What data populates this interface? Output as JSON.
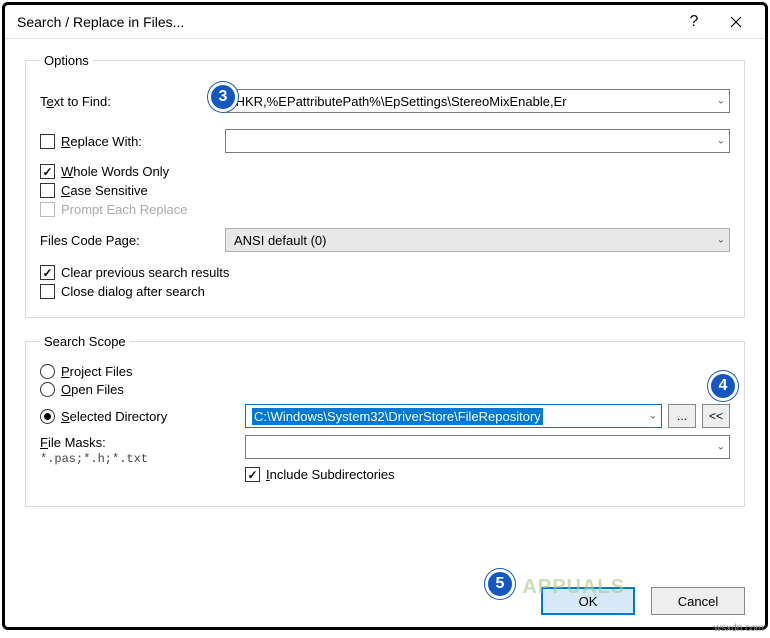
{
  "window": {
    "title": "Search / Replace in Files..."
  },
  "options": {
    "legend": "Options",
    "text_to_find_label_pre": "T",
    "text_to_find_label_u": "e",
    "text_to_find_label_post": "xt to Find:",
    "text_to_find_value": ";HKR,%EPattributePath%\\EpSettings\\StereoMixEnable,Er",
    "replace_with_label_u": "R",
    "replace_with_label_post": "eplace With:",
    "replace_with_value": "",
    "whole_words_u": "W",
    "whole_words_post": "hole Words Only",
    "case_sensitive_u": "C",
    "case_sensitive_post": "ase Sensitive",
    "prompt_each": "Prompt Each Replace",
    "code_page_label": "Files Code Page:",
    "code_page_value": "ANSI default (0)",
    "clear_prev": "Clear previous search results",
    "close_after": "Close dialog after search"
  },
  "scope": {
    "legend": "Search Scope",
    "project_files_u": "P",
    "project_files_post": "roject Files",
    "open_files_u": "O",
    "open_files_post": "pen Files",
    "selected_dir_u": "S",
    "selected_dir_post": "elected Directory",
    "directory_value": "C:\\Windows\\System32\\DriverStore\\FileRepository",
    "browse_btn": "...",
    "collapse_btn": "<<",
    "file_masks_label_u": "F",
    "file_masks_label_post": "ile Masks:",
    "file_masks_value": "",
    "file_masks_hint": "*.pas;*.h;*.txt",
    "include_sub_u": "I",
    "include_sub_post": "nclude Subdirectories"
  },
  "buttons": {
    "ok": "OK",
    "cancel": "Cancel"
  },
  "badges": {
    "b3": "3",
    "b4": "4",
    "b5": "5"
  },
  "watermark": "wsxdn.com",
  "logo": "APPUALS"
}
